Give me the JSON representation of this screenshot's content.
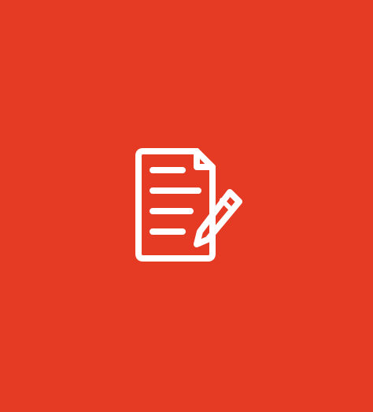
{
  "background_color": "#E53A24",
  "icon": {
    "name": "document-edit-icon",
    "color": "#FFFFFF"
  }
}
